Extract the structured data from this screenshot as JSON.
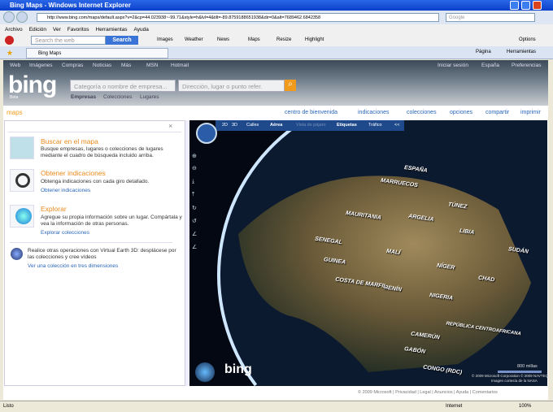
{
  "window": {
    "title": "Bing Maps - Windows Internet Explorer"
  },
  "address": {
    "url": "http://www.bing.com/maps/default.aspx?v=2&cp=44.023938~-99.71&style=h&lvl=4&tilt=-89.8759188651938&dir=0&alt=7689462.6842358",
    "search_placeholder": "Google"
  },
  "menu": [
    "Archivo",
    "Edición",
    "Ver",
    "Favoritos",
    "Herramientas",
    "Ayuda"
  ],
  "toolbar": {
    "search_placeholder": "Search the web",
    "search_btn": "Search",
    "items": [
      "Images",
      "Weather",
      "News",
      "Maps",
      "Resize",
      "Highlight"
    ],
    "options": "Options"
  },
  "tab": {
    "title": "Bing Maps",
    "cmd": [
      "Página",
      "Herramientas"
    ]
  },
  "bing": {
    "nav": [
      "Web",
      "Imágenes",
      "Compras",
      "Noticias",
      "Más",
      "MSN",
      "Hotmail"
    ],
    "right_nav": [
      "Iniciar sesión",
      "España",
      "Preferencias"
    ],
    "logo": "bing",
    "beta": "Beta",
    "what_placeholder": "Categoría o nombre de empresa...",
    "where_placeholder": "Dirección, lugar o punto refer.",
    "tabs": [
      "Empresas",
      "Colecciones",
      "Lugares"
    ]
  },
  "maps_label": "maps",
  "toplinks": [
    "centro de bienvenida",
    "indicaciones",
    "colecciones",
    "opciones",
    "compartir",
    "imprimir"
  ],
  "panel": {
    "close": "×",
    "features": [
      {
        "title": "Buscar en el mapa",
        "desc": "Busque empresas, lugares o colecciones de lugares mediante el cuadro de búsqueda incluido arriba.",
        "link": ""
      },
      {
        "title": "Obtener indicaciones",
        "desc": "Obtenga indicaciones con cada giro detallado.",
        "link": "Obtener indicaciones"
      },
      {
        "title": "Explorar",
        "desc": "Agregue su propia información sobre un lugar. Compártala y vea la información de otras personas.",
        "link": "Explorar colecciones"
      }
    ],
    "ve3d_text": "Realice otras operaciones con Virtual Earth 3D: desplácese por las colecciones y cree vídeos",
    "ve3d_link": "Ver una colección en tres dimensiones"
  },
  "mapbar": {
    "items": [
      "2D",
      "3D",
      "Calles",
      "Aérea",
      "Vista de pájaro",
      "Etiquetas",
      "Tráfico",
      "<<"
    ]
  },
  "map": {
    "labels": [
      "ESPAÑA",
      "MARRUECOS",
      "TÚNEZ",
      "ARGELIA",
      "LIBIA",
      "MAURITANIA",
      "MALÍ",
      "NÍGER",
      "SENEGAL",
      "GUINEA",
      "BENÍN",
      "COSTA DE MARFIL",
      "NIGERIA",
      "CHAD",
      "CAMERÚN",
      "REPÚBLICA CENTROAFRICANA",
      "GABÓN",
      "CONGO (RDC)",
      "SUDÁN"
    ],
    "scale": "800 millas",
    "copyright": "© 2009 Microsoft Corporation  © 2009 NAVTEQ",
    "imagery": "Imagen cortesía de la NASA",
    "logo": "bing"
  },
  "footer": "© 2009 Microsoft  |  Privacidad  |  Legal  |  Anuncios  |  Ayuda  |  Comentarios",
  "status": {
    "left": "Listo",
    "zone": "Internet",
    "zoom": "100%"
  }
}
